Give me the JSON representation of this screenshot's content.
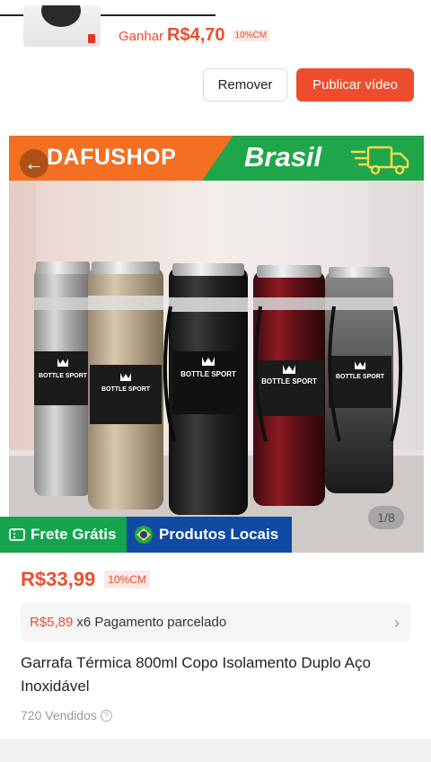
{
  "earnings": {
    "label": "Ganhar",
    "amount": "R$4,70",
    "commission": "10%CM"
  },
  "actions": {
    "remove_label": "Remover",
    "publish_label": "Publicar vídeo"
  },
  "product_image": {
    "brand_name": "DAFUSHOP",
    "country": "Brasil",
    "bottle_label": "BOTTLE SPORT",
    "image_counter": "1/8",
    "badges": {
      "free_shipping": "Frete Grátis",
      "local_products": "Produtos Locais"
    }
  },
  "product": {
    "price": "R$33,99",
    "commission": "10%CM",
    "installment_amount": "R$5,89",
    "installment_text": "x6 Pagamento parcelado",
    "title": "Garrafa Térmica 800ml Copo Isolamento Duplo Aço Inoxidável",
    "sold": "720 Vendidos"
  },
  "colors": {
    "accent": "#ee4d2d",
    "banner_orange": "#f36f21",
    "banner_green": "#1fa64a",
    "badge_green": "#14a44d",
    "badge_blue": "#0f4aa3"
  },
  "icons": [
    "back-arrow-icon",
    "truck-icon",
    "ticket-icon",
    "brazil-flag-icon",
    "chevron-right-icon",
    "help-icon"
  ]
}
